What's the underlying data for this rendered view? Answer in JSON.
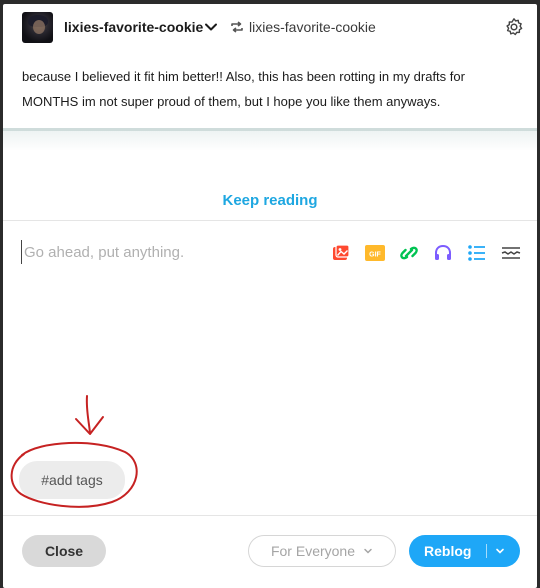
{
  "header": {
    "username": "lixies-favorite-cookie",
    "reblog_source": "lixies-favorite-cookie",
    "icons": [
      "avatar",
      "chevron-down-icon",
      "reblog-icon",
      "gear-icon"
    ]
  },
  "post": {
    "line1": "because I believed it fit him better!! Also, this has been rotting in my drafts for",
    "line2": "MONTHS im not super proud of them, but I hope you like them anyways."
  },
  "keep_reading": "Keep reading",
  "editor": {
    "placeholder": "Go ahead, put anything.",
    "tools": [
      "photo-icon",
      "gif-icon",
      "link-icon",
      "audio-icon",
      "checklist-icon",
      "read-more-icon"
    ],
    "gif_label": "GIF"
  },
  "tags": {
    "placeholder": "#add tags"
  },
  "footer": {
    "close_label": "Close",
    "audience_label": "For Everyone",
    "reblog_label": "Reblog"
  },
  "colors": {
    "accent": "#1ea7f7",
    "keep_reading": "#1ea7e1",
    "annotation": "#c62222"
  }
}
